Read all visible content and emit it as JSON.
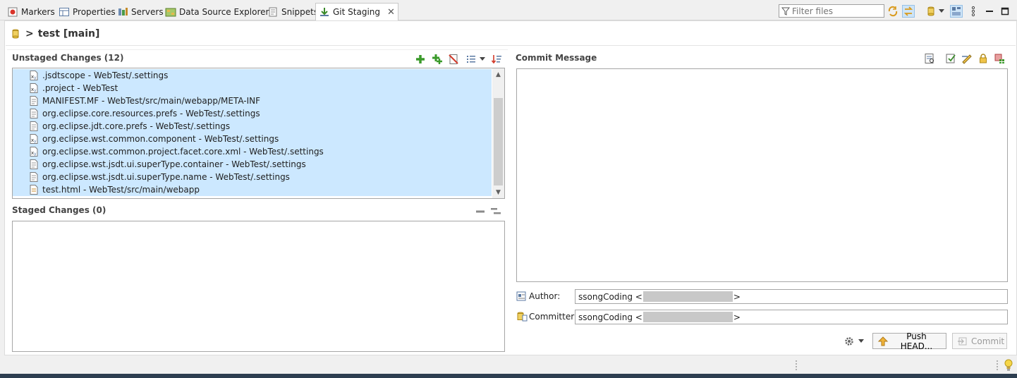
{
  "tabs": [
    {
      "label": "Markers",
      "icon": "markers-icon"
    },
    {
      "label": "Properties",
      "icon": "properties-icon"
    },
    {
      "label": "Servers",
      "icon": "servers-icon"
    },
    {
      "label": "Data Source Explorer",
      "icon": "data-source-icon"
    },
    {
      "label": "Snippets",
      "icon": "snippets-icon"
    },
    {
      "label": "Git Staging",
      "icon": "git-staging-icon",
      "active": true,
      "close": "✕"
    }
  ],
  "toolbar": {
    "filter_placeholder": "Filter files"
  },
  "repo": {
    "prefix": ">",
    "title": "test [main]"
  },
  "unstaged": {
    "title": "Unstaged Changes (12)",
    "files": [
      ".jsdtscope - WebTest/.settings",
      ".project - WebTest",
      "MANIFEST.MF - WebTest/src/main/webapp/META-INF",
      "org.eclipse.core.resources.prefs - WebTest/.settings",
      "org.eclipse.jdt.core.prefs - WebTest/.settings",
      "org.eclipse.wst.common.component - WebTest/.settings",
      "org.eclipse.wst.common.project.facet.core.xml - WebTest/.settings",
      "org.eclipse.wst.jsdt.ui.superType.container - WebTest/.settings",
      "org.eclipse.wst.jsdt.ui.superType.name - WebTest/.settings",
      "test.html - WebTest/src/main/webapp"
    ]
  },
  "staged": {
    "title": "Staged Changes (0)"
  },
  "commit": {
    "title": "Commit Message",
    "message": "",
    "author_label": "Author:",
    "author_name": "ssongCoding <",
    "author_suffix": ">",
    "committer_label": "Committer:",
    "committer_name": "ssongCoding <",
    "committer_suffix": ">",
    "push_label": "Push HEAD...",
    "commit_label": "Commit"
  },
  "colors": {
    "selection": "#cce8ff",
    "toggled": "#cde4f7",
    "add_green": "#3a9a2a",
    "bottom_strip": "#2d3e50"
  }
}
